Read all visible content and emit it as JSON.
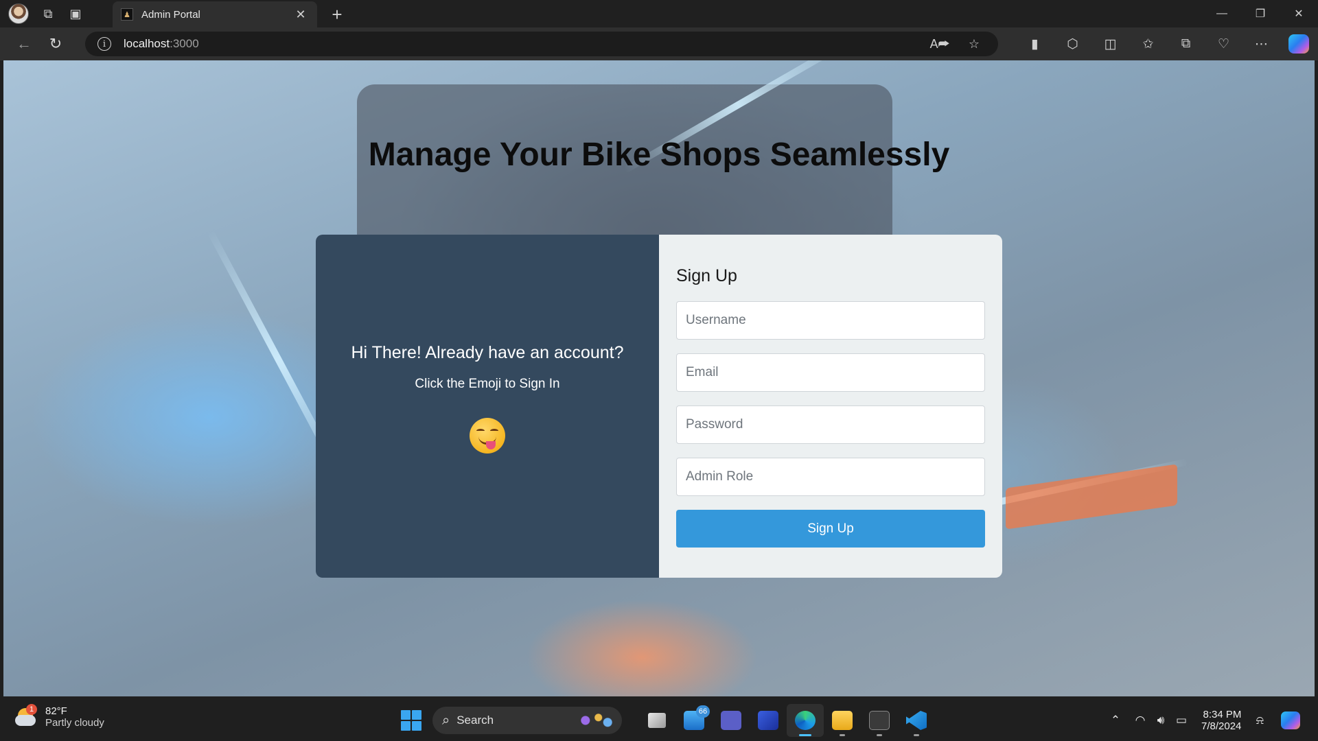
{
  "browser": {
    "tab": {
      "title": "Admin Portal",
      "favicon": "admin-portal-favicon"
    },
    "address": {
      "host": "localhost",
      "port": ":3000"
    },
    "icons": {
      "title_bar": [
        "workspaces-icon",
        "vertical-tabs-icon"
      ],
      "address_right": [
        "read-aloud-icon",
        "favorite-star-icon"
      ],
      "toolbar": [
        "browser-essentials-icon",
        "extensions-icon",
        "split-screen-icon",
        "favorites-icon",
        "collections-icon",
        "performance-icon",
        "settings-more-icon",
        "copilot-icon"
      ]
    }
  },
  "page": {
    "headline": "Manage Your Bike Shops Seamlessly",
    "left_panel": {
      "heading": "Hi There! Already have an account?",
      "subtext": "Click the Emoji to Sign In",
      "emoji": "face-savoring-food-emoji"
    },
    "form": {
      "title": "Sign Up",
      "username_placeholder": "Username",
      "email_placeholder": "Email",
      "password_placeholder": "Password",
      "role_placeholder": "Admin Role",
      "submit_label": "Sign Up"
    },
    "colors": {
      "left_panel_bg": "#34495e",
      "right_panel_bg": "#ecf0f1",
      "button_bg": "#3498db"
    }
  },
  "taskbar": {
    "weather": {
      "badge": "1",
      "temp": "82°F",
      "condition": "Partly cloudy"
    },
    "search_label": "Search",
    "mail_badge": "66",
    "apps": [
      "task-view-icon",
      "mail-icon",
      "teams-icon",
      "power-automate-icon",
      "edge-icon",
      "file-explorer-icon",
      "terminal-icon",
      "vscode-icon"
    ],
    "clock": {
      "time": "8:34 PM",
      "date": "7/8/2024"
    }
  }
}
